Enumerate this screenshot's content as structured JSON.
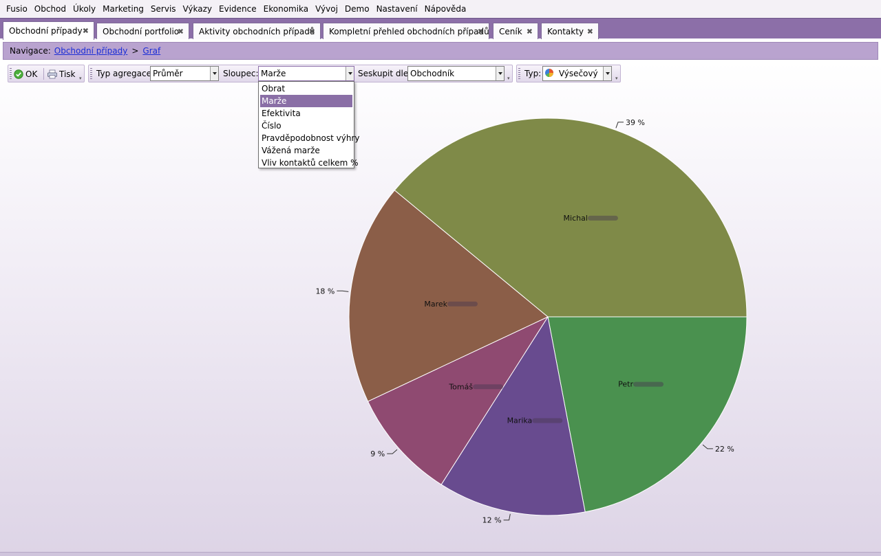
{
  "menu": [
    "Fusio",
    "Obchod",
    "Úkoly",
    "Marketing",
    "Servis",
    "Výkazy",
    "Evidence",
    "Ekonomika",
    "Vývoj",
    "Demo",
    "Nastavení",
    "Nápověda"
  ],
  "tabs": [
    {
      "label": "Obchodní případy",
      "active": true
    },
    {
      "label": "Obchodní portfolio",
      "active": false
    },
    {
      "label": "Aktivity obchodních případů",
      "active": false
    },
    {
      "label": "Kompletní přehled obchodních případů",
      "active": false
    },
    {
      "label": "Ceník",
      "active": false
    },
    {
      "label": "Kontakty",
      "active": false
    }
  ],
  "breadcrumb": {
    "label": "Navigace:",
    "items": [
      "Obchodní případy",
      "Graf"
    ],
    "separator": ">"
  },
  "toolbar": {
    "ok_label": "OK",
    "print_label": "Tisk",
    "aggregation_label": "Typ agregace:",
    "aggregation_value": "Průměr",
    "column_label": "Sloupec:",
    "column_value": "Marže",
    "group_label": "Seskupit dle:",
    "group_value": "Obchodník",
    "type_label": "Typ:",
    "type_value": "Výsečový"
  },
  "column_dropdown": {
    "options": [
      "Obrat",
      "Marže",
      "Efektivita",
      "Číslo",
      "Pravděpodobnost výhry",
      "Vážená marže",
      "Vliv kontaktů celkem %"
    ],
    "selected_index": 1
  },
  "icons": {
    "ok": "check-circle-icon",
    "print": "printer-icon",
    "chart_type": "pie-chart-icon",
    "tab_close": "close-icon"
  },
  "colors": {
    "accent": "#8c6fa8",
    "navbar": "#b9a3cf"
  },
  "chart_data": {
    "type": "pie",
    "title": "",
    "slices": [
      {
        "label": "Petr",
        "value": 22,
        "pct_label": "22 %",
        "color": "#4a914f"
      },
      {
        "label": "Marika",
        "value": 12,
        "pct_label": "12 %",
        "color": "#684b8f"
      },
      {
        "label": "Tomáš",
        "value": 9,
        "pct_label": "9 %",
        "color": "#8f4a71"
      },
      {
        "label": "Marek",
        "value": 18,
        "pct_label": "18 %",
        "color": "#8b5e48"
      },
      {
        "label": "Michal",
        "value": 39,
        "pct_label": "39 %",
        "color": "#7f8a48"
      }
    ],
    "start_angle_deg": 0,
    "direction": "clockwise",
    "names_partially_obscured": true
  }
}
